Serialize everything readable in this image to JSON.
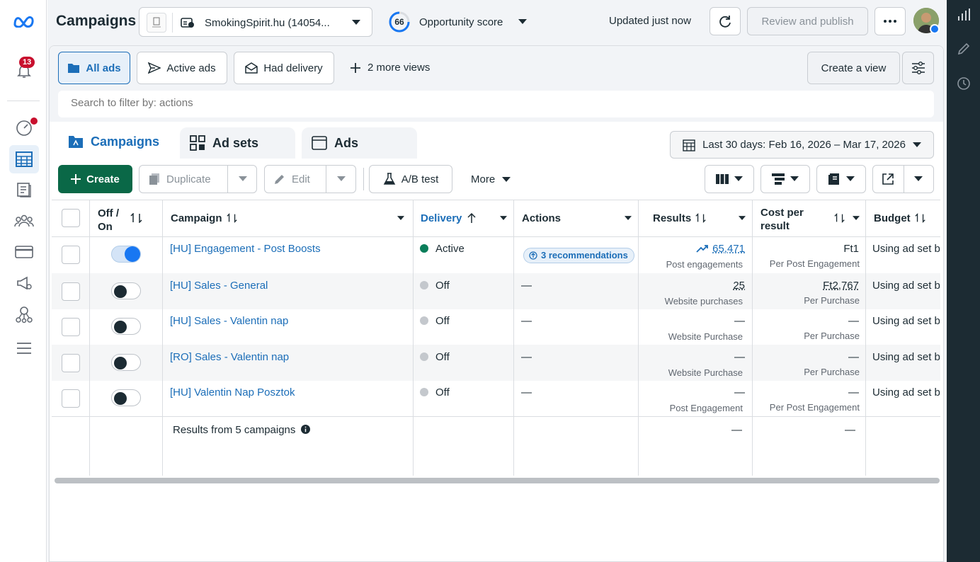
{
  "colors": {
    "brand_blue": "#1877f2",
    "create_green": "#0a6847",
    "active_green": "#0a7e5a",
    "off_grey": "#c4c8cd",
    "link_blue": "#1c6eb8",
    "rail_dark": "#1c2b33"
  },
  "leftnav": {
    "notification_count": "13",
    "icons": [
      "meta-logo-icon",
      "bell-icon",
      "dashboard-gauge-icon",
      "table-grid-icon",
      "pages-icon",
      "audience-people-icon",
      "billing-card-icon",
      "megaphone-settings-icon",
      "network-icon",
      "hamburger-menu-icon"
    ]
  },
  "rightrail": {
    "icons": [
      "bar-chart-icon",
      "pencil-icon",
      "clock-icon"
    ]
  },
  "header": {
    "title": "Campaigns",
    "account_name": "SmokingSpirit.hu (14054...",
    "opportunity_value": "66",
    "opportunity_label": "Opportunity score",
    "updated_text": "Updated just now",
    "review_publish_label": "Review and publish"
  },
  "views": {
    "all_ads": "All ads",
    "active_ads": "Active ads",
    "had_delivery": "Had delivery",
    "more_views": "2 more views",
    "create_view": "Create a view"
  },
  "search": {
    "placeholder": "Search to filter by: actions"
  },
  "tabs": {
    "campaigns": "Campaigns",
    "ad_sets": "Ad sets",
    "ads": "Ads"
  },
  "date_range": "Last 30 days: Feb 16, 2026 – Mar 17, 2026",
  "toolbar": {
    "create": "Create",
    "duplicate": "Duplicate",
    "edit": "Edit",
    "ab_test": "A/B test",
    "more": "More"
  },
  "table": {
    "headers": {
      "off_on_line1": "Off /",
      "off_on_line2": "On",
      "campaign": "Campaign",
      "delivery": "Delivery",
      "actions": "Actions",
      "results": "Results",
      "cost_line1": "Cost per",
      "cost_line2": "result",
      "budget": "Budget"
    },
    "rows": [
      {
        "on": true,
        "campaign": "[HU] Engagement - Post Boosts",
        "delivery": "Active",
        "actions": "3 recommendations",
        "results": "65,471",
        "results_sub": "Post engagements",
        "cost": "Ft1",
        "cost_sub": "Per Post Engagement",
        "budget": "Using ad set b"
      },
      {
        "on": false,
        "campaign": "[HU] Sales - General",
        "delivery": "Off",
        "actions": "—",
        "results": "25",
        "results_sub": "Website purchases",
        "cost": "Ft2,767",
        "cost_sub": "Per Purchase",
        "budget": "Using ad set b"
      },
      {
        "on": false,
        "campaign": "[HU] Sales - Valentin nap",
        "delivery": "Off",
        "actions": "—",
        "results": "—",
        "results_sub": "Website Purchase",
        "cost": "—",
        "cost_sub": "Per Purchase",
        "budget": "Using ad set b"
      },
      {
        "on": false,
        "campaign": "[RO] Sales - Valentin nap",
        "delivery": "Off",
        "actions": "—",
        "results": "—",
        "results_sub": "Website Purchase",
        "cost": "—",
        "cost_sub": "Per Purchase",
        "budget": "Using ad set b"
      },
      {
        "on": false,
        "campaign": "[HU] Valentin Nap Posztok",
        "delivery": "Off",
        "actions": "—",
        "results": "—",
        "results_sub": "Post Engagement",
        "cost": "—",
        "cost_sub": "Per Post Engagement",
        "budget": "Using ad set b"
      }
    ],
    "summary": {
      "label": "Results from 5 campaigns",
      "results": "—",
      "cost": "—"
    }
  }
}
